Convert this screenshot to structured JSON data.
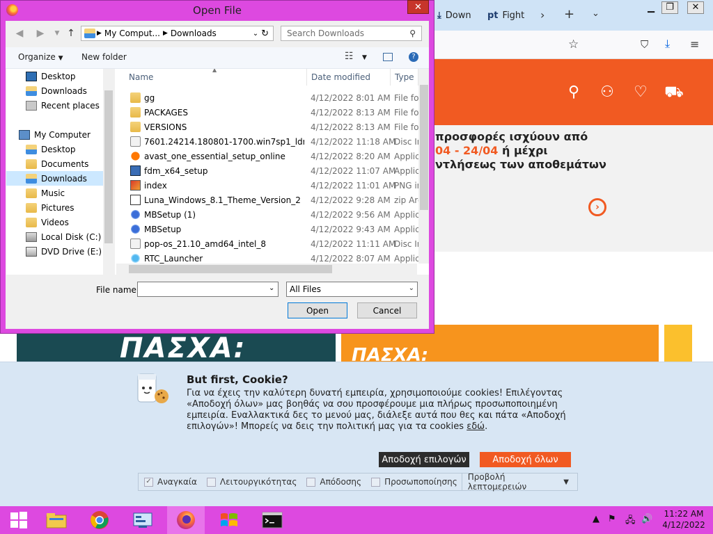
{
  "dialog": {
    "title": "Open File",
    "close": "✕",
    "address": [
      "My Comput...",
      "Downloads"
    ],
    "search_placeholder": "Search Downloads",
    "toolbar": {
      "organize": "Organize",
      "new_folder": "New folder"
    },
    "nav": [
      {
        "label": "Desktop",
        "icon": "desktop-icon"
      },
      {
        "label": "Downloads",
        "icon": "folder-icon"
      },
      {
        "label": "Recent places",
        "icon": "recent-places-icon"
      },
      {
        "label": "My Computer",
        "icon": "computer-icon"
      },
      {
        "label": "Desktop",
        "icon": "folder-icon"
      },
      {
        "label": "Documents",
        "icon": "folder-icon"
      },
      {
        "label": "Downloads",
        "icon": "folder-icon",
        "selected": true
      },
      {
        "label": "Music",
        "icon": "folder-icon"
      },
      {
        "label": "Pictures",
        "icon": "folder-icon"
      },
      {
        "label": "Videos",
        "icon": "folder-icon"
      },
      {
        "label": "Local Disk (C:)",
        "icon": "disk-icon"
      },
      {
        "label": "DVD Drive (E:) CC",
        "icon": "dvd-icon"
      }
    ],
    "columns": {
      "name": "Name",
      "date": "Date modified",
      "type": "Type"
    },
    "files": [
      {
        "name": "gg",
        "date": "4/12/2022 8:01 AM",
        "type": "File fol",
        "icon": "folder"
      },
      {
        "name": "PACKAGES",
        "date": "4/12/2022 8:13 AM",
        "type": "File fol",
        "icon": "folder"
      },
      {
        "name": "VERSIONS",
        "date": "4/12/2022 8:13 AM",
        "type": "File fol",
        "icon": "folder"
      },
      {
        "name": "7601.24214.180801-1700.win7sp1_ldr_escr...",
        "date": "4/12/2022 11:18 AM",
        "type": "Disc In",
        "icon": "disc"
      },
      {
        "name": "avast_one_essential_setup_online",
        "date": "4/12/2022 8:20 AM",
        "type": "Applic",
        "icon": "avast"
      },
      {
        "name": "fdm_x64_setup",
        "date": "4/12/2022 11:07 AM",
        "type": "Applic",
        "icon": "fdm"
      },
      {
        "name": "index",
        "date": "4/12/2022 11:01 AM",
        "type": "PNG in",
        "icon": "png"
      },
      {
        "name": "Luna_Windows_8.1_Theme_Version_2",
        "date": "4/12/2022 9:28 AM",
        "type": "zip Arc",
        "icon": "zip"
      },
      {
        "name": "MBSetup (1)",
        "date": "4/12/2022 9:56 AM",
        "type": "Applic",
        "icon": "mb"
      },
      {
        "name": "MBSetup",
        "date": "4/12/2022 9:43 AM",
        "type": "Applic",
        "icon": "mb"
      },
      {
        "name": "pop-os_21.10_amd64_intel_8",
        "date": "4/12/2022 11:11 AM",
        "type": "Disc In",
        "icon": "disc"
      },
      {
        "name": "RTC_Launcher",
        "date": "4/12/2022 8:07 AM",
        "type": "Applic",
        "icon": "rtc"
      }
    ],
    "file_name_label": "File name:",
    "file_name_value": "",
    "filter": "All Files",
    "open": "Open",
    "cancel": "Cancel"
  },
  "browser": {
    "tabs": [
      {
        "icon_text": "⤓",
        "label": "Down"
      },
      {
        "icon_text": "pt",
        "label": "Fight"
      }
    ],
    "promo": {
      "line1": "προσφορές ισχύουν από",
      "line2_orange": "04 - 24/04",
      "line2_rest": " ή μέχρι",
      "line3": "ντλήσεως των αποθεμάτων"
    },
    "banner_left": "ΠΑΣΧΑ:",
    "banner_mid": "ΠΑΣΧΑ:"
  },
  "cookie": {
    "title": "But first, Cookie?",
    "text": "Για να έχεις την καλύτερη δυνατή εμπειρία, χρησιμοποιούμε cookies! Επιλέγοντας «Αποδοχή όλων» μας βοηθάς να σου προσφέρουμε μια πλήρως προσωποποιημένη εμπειρία. Εναλλακτικά δες το μενού μας, διάλεξε αυτά που θες και πάτα «Αποδοχή επιλογών»! Μπορείς να δεις την πολιτική μας για τα cookies ",
    "link": "εδώ",
    "text_end": ".",
    "accept_selected": "Αποδοχή επιλογών",
    "accept_all": "Αποδοχή όλων",
    "options": [
      {
        "label": "Αναγκαία",
        "checked": true
      },
      {
        "label": "Λειτουργικότητας",
        "checked": false
      },
      {
        "label": "Απόδοσης",
        "checked": false
      },
      {
        "label": "Προσωποποίησης",
        "checked": false
      }
    ],
    "details": "Προβολή λεπτομερειών"
  },
  "taskbar": {
    "time": "11:22 AM",
    "date": "4/12/2022"
  }
}
